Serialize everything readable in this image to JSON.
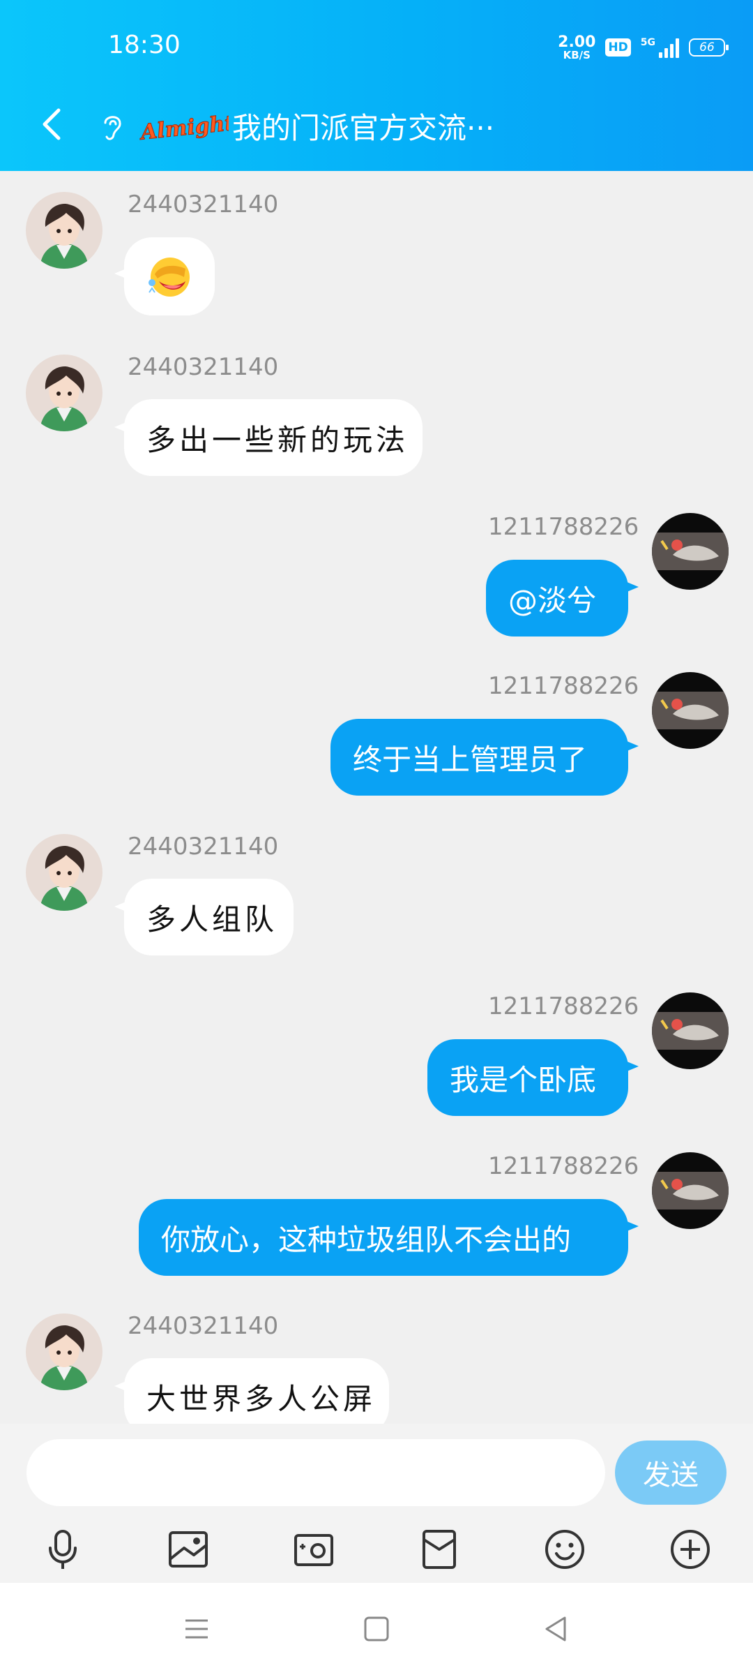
{
  "status_bar": {
    "time": "18:30",
    "net_speed_value": "2.00",
    "net_speed_unit": "KB/S",
    "hd_label": "HD",
    "signal_label": "5G",
    "battery": "66"
  },
  "header": {
    "group_logo_text": "Almighty",
    "title": "我的门派官方交流···"
  },
  "messages": [
    {
      "sender": "2440321140",
      "direction": "in",
      "type": "emoji",
      "emoji_icon": "facepalm-laugh-emoji"
    },
    {
      "sender": "2440321140",
      "direction": "in",
      "text": "多出一些新的玩法"
    },
    {
      "sender": "1211788226",
      "direction": "out",
      "text": "@淡兮"
    },
    {
      "sender": "1211788226",
      "direction": "out",
      "text": "终于当上管理员了"
    },
    {
      "sender": "2440321140",
      "direction": "in",
      "text": "多人组队"
    },
    {
      "sender": "1211788226",
      "direction": "out",
      "text": "我是个卧底"
    },
    {
      "sender": "1211788226",
      "direction": "out",
      "text": "你放心，这种垃圾组队不会出的"
    },
    {
      "sender": "2440321140",
      "direction": "in",
      "text": "大世界多人公屏"
    }
  ],
  "input_bar": {
    "input_value": "",
    "send_label": "发送"
  },
  "toolbar_icons": [
    "microphone-icon",
    "image-icon",
    "camera-icon",
    "red-packet-icon",
    "emoji-icon",
    "plus-icon"
  ],
  "colors": {
    "header_start": "#0bc6fb",
    "header_end": "#0a9cf6",
    "outgoing_bubble": "#0aa2f4",
    "incoming_bubble": "#ffffff",
    "send_button": "#7bcaf6",
    "background": "#f0f0f0"
  }
}
